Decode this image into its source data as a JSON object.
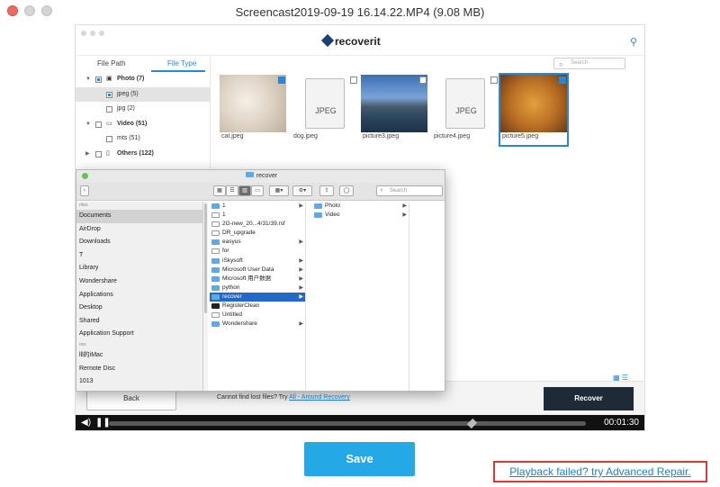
{
  "window": {
    "title": "Screencast2019-09-19 16.14.22.MP4 (9.08 MB)"
  },
  "app": {
    "logo_text": "recoverit",
    "key_icon": "key-icon",
    "tabs": [
      "File Path",
      "File Type"
    ],
    "search_placeholder": "Search",
    "tree": [
      {
        "label": "Photo (7)"
      },
      {
        "label": "jpeg (5)"
      },
      {
        "label": "jpg (2)"
      },
      {
        "label": "Video (51)"
      },
      {
        "label": "mts (51)"
      },
      {
        "label": "Others (122)"
      }
    ],
    "thumbnails": [
      {
        "name": "cat.jpeg"
      },
      {
        "name": "dog.jpeg",
        "doc_label": "JPEG"
      },
      {
        "name": "picture3.jpeg"
      },
      {
        "name": "picture4.jpeg",
        "doc_label": "JPEG"
      },
      {
        "name": "picture5.jpeg"
      }
    ],
    "back_label": "Back",
    "lost_text": "Cannot find lost files? Try ",
    "lost_link": "All - Around Recovery",
    "recover_label": "Recover"
  },
  "finder": {
    "title": "recover",
    "search_placeholder": "Search",
    "sidebar": [
      {
        "label": "rites",
        "header": true
      },
      {
        "label": "Documents",
        "selected": true
      },
      {
        "label": "AirDrop"
      },
      {
        "label": "Downloads"
      },
      {
        "label": "T"
      },
      {
        "label": "Library"
      },
      {
        "label": "Wondershare"
      },
      {
        "label": "Applications"
      },
      {
        "label": "Desktop"
      },
      {
        "label": "Shared"
      },
      {
        "label": "Application Support"
      },
      {
        "label": "ces",
        "header": true
      },
      {
        "label": "lll的iMac"
      },
      {
        "label": "Remote Disc"
      },
      {
        "label": "1013"
      }
    ],
    "column1": [
      {
        "label": "1",
        "icon": "folder",
        "arrow": true
      },
      {
        "label": "1",
        "icon": "file"
      },
      {
        "label": "2G-new_20...4/31/39.rsf",
        "icon": "file"
      },
      {
        "label": "DR_upgrade",
        "icon": "file"
      },
      {
        "label": "easyus",
        "icon": "folder",
        "arrow": true
      },
      {
        "label": "for",
        "icon": "file"
      },
      {
        "label": "iSkysoft",
        "icon": "folder",
        "arrow": true
      },
      {
        "label": "Microsoft User Data",
        "icon": "folder",
        "arrow": true
      },
      {
        "label": "Microsoft 用户数据",
        "icon": "folder",
        "arrow": true
      },
      {
        "label": "python",
        "icon": "folder",
        "arrow": true
      },
      {
        "label": "recover",
        "icon": "folder",
        "arrow": true,
        "selected": true
      },
      {
        "label": "RegisterClean",
        "icon": "dark"
      },
      {
        "label": "Untitled",
        "icon": "file"
      },
      {
        "label": "Wondershare",
        "icon": "folder",
        "arrow": true
      }
    ],
    "column2": [
      {
        "label": "Photo",
        "icon": "folder",
        "arrow": true
      },
      {
        "label": "Video",
        "icon": "folder",
        "arrow": true
      }
    ]
  },
  "player": {
    "time": "00:01:30",
    "progress": 0.76
  },
  "save_label": "Save",
  "repair_link": "Playback failed? try Advanced Repair."
}
